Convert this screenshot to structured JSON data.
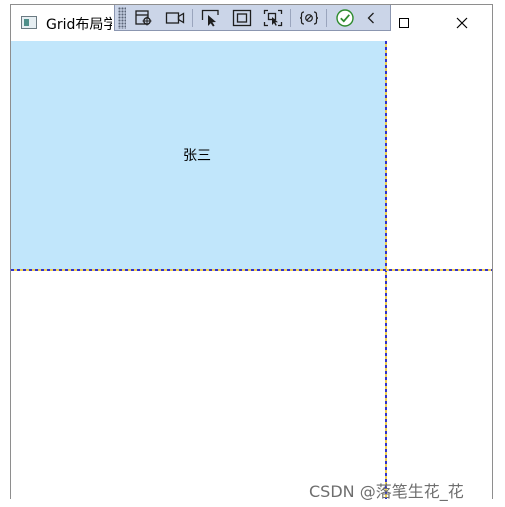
{
  "window": {
    "title": "Grid布局学"
  },
  "toolbar": {
    "buttons": [
      {
        "icon": "live-visual-tree-icon"
      },
      {
        "icon": "video-camera-icon"
      },
      {
        "icon": "select-element-icon"
      },
      {
        "icon": "display-layout-adorners-icon"
      },
      {
        "icon": "track-focused-element-icon"
      },
      {
        "icon": "binding-failures-icon"
      },
      {
        "icon": "hot-reload-ok-icon"
      },
      {
        "icon": "collapse-chevron-icon"
      }
    ]
  },
  "grid": {
    "cell_label": "张三",
    "cell_color": "#c1e6fb",
    "gridline_colors": [
      "#3333cc",
      "#f0d050"
    ]
  },
  "watermark": {
    "text": "CSDN @落笔生花_花"
  }
}
